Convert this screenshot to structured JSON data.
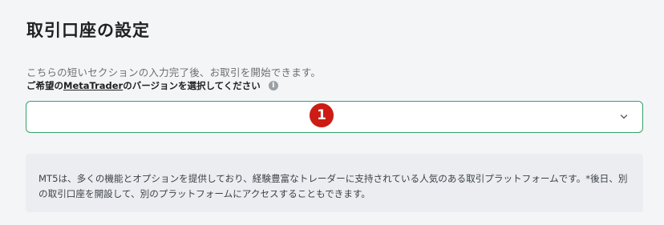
{
  "page": {
    "title": "取引口座の設定",
    "subtitle": "こちらの短いセクションの入力完了後、お取引を開始できます。",
    "question_prefix": "ご希望の",
    "question_link": "MetaTrader",
    "question_suffix": "のバージョンを選択してください",
    "info_glyph": "i"
  },
  "select": {
    "value": "",
    "icon": "chevron-down-icon"
  },
  "annotation": {
    "badge_number": "1",
    "badge_color": "#cc1c14"
  },
  "info_box": {
    "line1": "MT5は、多くの機能とオプションを提供しており、経験豊富なトレーダーに支持されている人気のある取引プラットフォームです。*後日、別",
    "line2": "の取引口座を開設して、別のプラットフォームにアクセスすることもできます。"
  },
  "colors": {
    "accent_border": "#35a06b",
    "background": "#f4f5f6",
    "info_bg": "#ebedf0"
  }
}
